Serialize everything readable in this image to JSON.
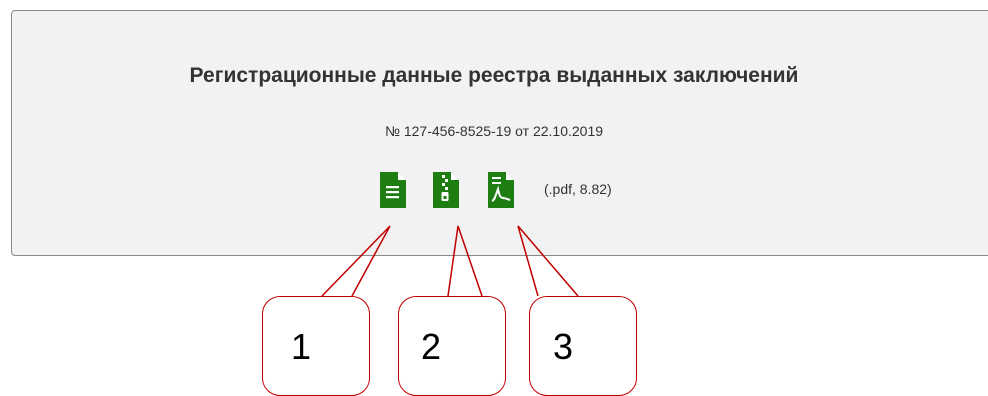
{
  "panel": {
    "title": "Регистрационные данные реестра выданных заключений",
    "subtitle": "№ 127-456-8525-19 от 22.10.2019",
    "file_info": "(.pdf, 8.82)",
    "icons": [
      {
        "name": "document-text-icon"
      },
      {
        "name": "document-zip-icon"
      },
      {
        "name": "document-pdf-icon"
      }
    ],
    "icon_color": "#1e7e12"
  },
  "callouts": [
    {
      "label": "1"
    },
    {
      "label": "2"
    },
    {
      "label": "3"
    }
  ],
  "callout_color": "#c00000"
}
